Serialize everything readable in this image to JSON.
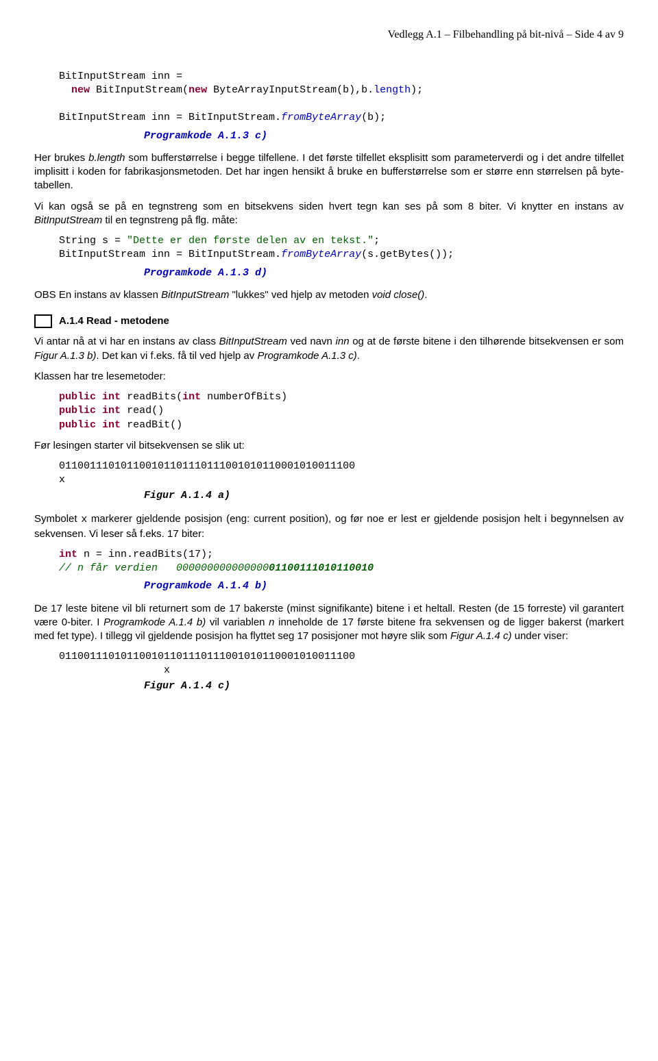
{
  "header": "Vedlegg A.1 – Filbehandling på bit-nivå – Side 4 av 9",
  "code1": {
    "l1a": "  BitInputStream inn =",
    "l2a": "    ",
    "l2_new": "new",
    "l2b": " BitInputStream(",
    "l2_new2": "new",
    "l2c": " ByteArrayInputStream(b),b.",
    "l2_len": "length",
    "l2d": ");",
    "l3": "",
    "l4a": "  BitInputStream inn = BitInputStream.",
    "l4_from": "fromByteArray",
    "l4b": "(b);"
  },
  "cap1": "Programkode A.1.3 c)",
  "p1a": "Her brukes ",
  "p1b": "b.length",
  "p1c": " som bufferstørrelse i begge tilfellene. I det første tilfellet eksplisitt som parameterverdi og i det andre tilfellet implisitt i koden for fabrikasjonsmetoden. Det har ingen hensikt å bruke en bufferstørrelse som er større enn størrelsen på byte-tabellen.",
  "p2a": "Vi kan også se på en tegnstreng som en bitsekvens siden hvert tegn kan ses på som 8 biter. Vi knytter en instans av ",
  "p2b": "BitInputStream",
  "p2c": " til en tegnstreng på flg. måte:",
  "code2": {
    "l1a": "  String s = ",
    "l1_str": "\"Dette er den første delen av en tekst.\"",
    "l1b": ";",
    "l2a": "  BitInputStream inn = BitInputStream.",
    "l2_from": "fromByteArray",
    "l2b": "(s.getBytes());"
  },
  "cap2": "Programkode A.1.3 d)",
  "p3a": "OBS En instans av klassen ",
  "p3b": "BitInputStream",
  "p3c": " \"lukkes\" ved hjelp av metoden ",
  "p3d": "void close()",
  "p3e": ".",
  "sect": "A.1.4  Read - metodene",
  "p4a": "Vi antar nå at vi har en instans av class ",
  "p4b": "BitInputStream",
  "p4c": " ved navn ",
  "p4d": "inn",
  "p4e": " og at de første bitene i den tilhørende bitsekvensen er som ",
  "p4f": "Figur A.1.3 b)",
  "p4g": ". Det kan vi f.eks. få til ved hjelp av ",
  "p4h": "Programkode A.1.3 c)",
  "p4i": ".",
  "p5": "Klassen har tre lesemetoder:",
  "code3": {
    "pub": "public",
    "int": "int",
    "l1a": " readBits(",
    "l1b": " numberOfBits)",
    "l2": " read()",
    "l3": " readBit()"
  },
  "p6": "Før lesingen starter vil bitsekvensen se slik ut:",
  "bits1": "  011001110101100101101110111001010110001010011100",
  "bits1x": "  x",
  "figcap1": "Figur A.1.4 a)",
  "p7a": "Symbolet ",
  "p7x": "x",
  "p7b": " markerer gjeldende posisjon (eng: current position), og før noe er lest er gjeldende posisjon helt i begynnelsen av sekvensen. Vi leser så f.eks. 17 biter:",
  "code4": {
    "int": "int",
    "l1": " n = inn.readBits(17);",
    "l2a": "// n får verdien   000000000000000",
    "l2b": "01100111010110010"
  },
  "cap3": "Programkode A.1.4 b)",
  "p8a": "De 17 leste bitene vil bli returnert som de 17 bakerste (minst signifikante) bitene i et heltall. Resten (de 15 forreste) vil garantert være 0-biter. I ",
  "p8b": "Programkode A.1.4 b)",
  "p8c": " vil variablen ",
  "p8d": "n",
  "p8e": " inneholde de 17 første bitene fra sekvensen og de ligger bakerst (markert med fet type). I tillegg vil gjeldende posisjon ha flyttet seg 17 posisjoner mot høyre slik som ",
  "p8f": "Figur A.1.4 c)",
  "p8g": " under viser:",
  "bits2": "  011001110101100101101110111001010110001010011100",
  "bits2x": "                   x",
  "figcap2": "Figur A.1.4 c)"
}
